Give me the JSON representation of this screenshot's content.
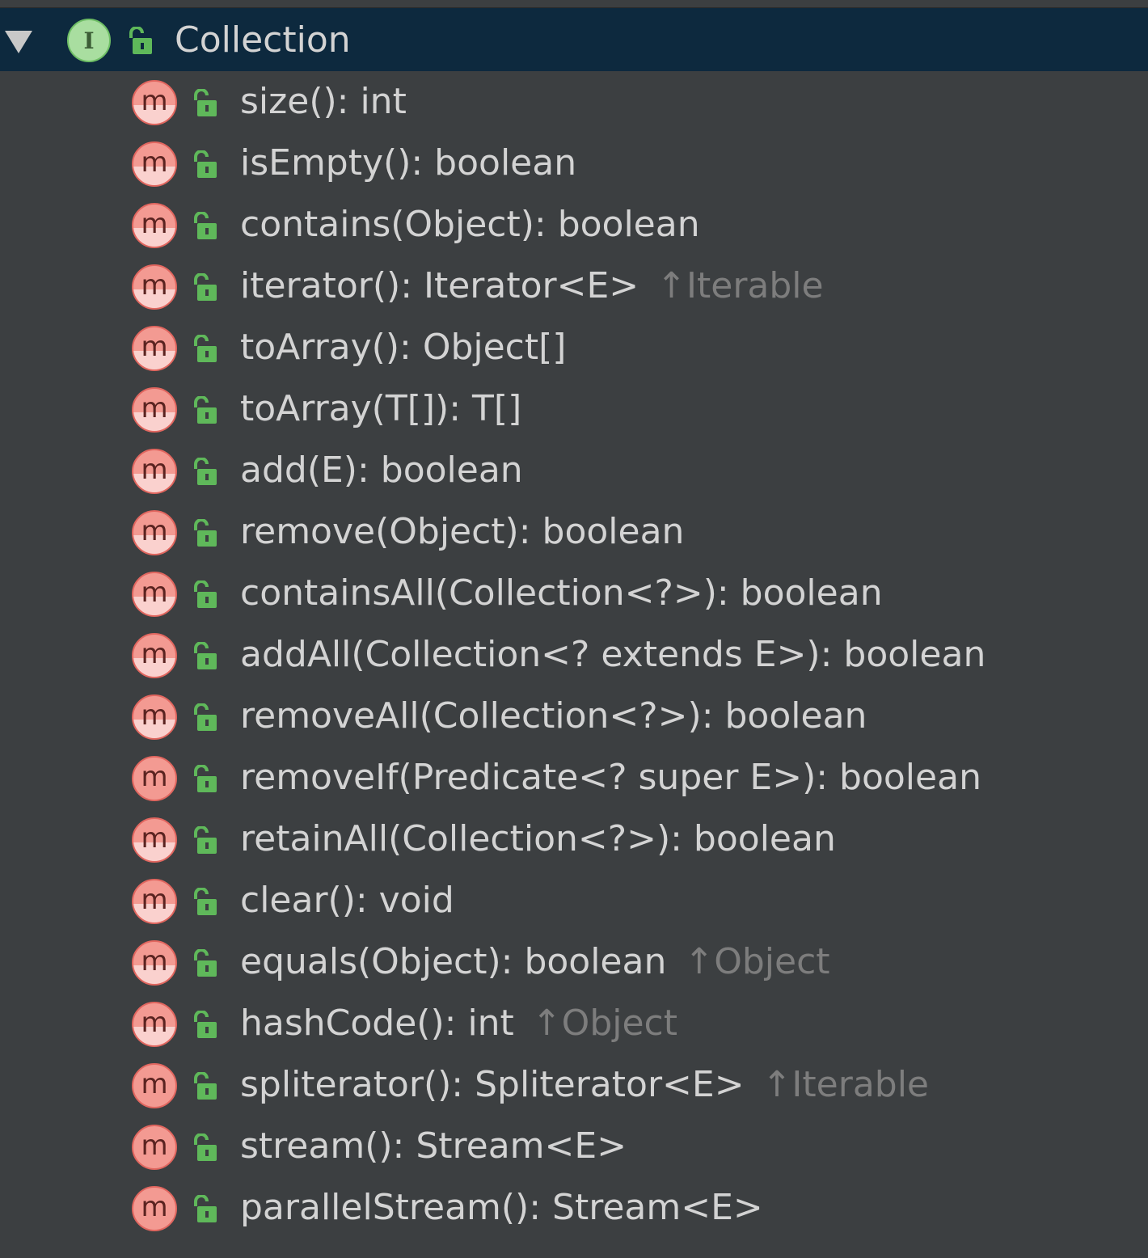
{
  "tree": {
    "root": {
      "label": "Collection",
      "icon": "interface-icon",
      "icon_letter": "I",
      "expanded": true,
      "selected": true
    },
    "members": [
      {
        "signature": "size(): int",
        "inherited": "",
        "abstract": true
      },
      {
        "signature": "isEmpty(): boolean",
        "inherited": "",
        "abstract": true
      },
      {
        "signature": "contains(Object): boolean",
        "inherited": "",
        "abstract": true
      },
      {
        "signature": "iterator(): Iterator<E>",
        "inherited": "↑Iterable",
        "abstract": true
      },
      {
        "signature": "toArray(): Object[]",
        "inherited": "",
        "abstract": true
      },
      {
        "signature": "toArray(T[]): T[]",
        "inherited": "",
        "abstract": true
      },
      {
        "signature": "add(E): boolean",
        "inherited": "",
        "abstract": true
      },
      {
        "signature": "remove(Object): boolean",
        "inherited": "",
        "abstract": true
      },
      {
        "signature": "containsAll(Collection<?>): boolean",
        "inherited": "",
        "abstract": true
      },
      {
        "signature": "addAll(Collection<? extends E>): boolean",
        "inherited": "",
        "abstract": true
      },
      {
        "signature": "removeAll(Collection<?>): boolean",
        "inherited": "",
        "abstract": true
      },
      {
        "signature": "removeIf(Predicate<? super E>): boolean",
        "inherited": "",
        "abstract": false
      },
      {
        "signature": "retainAll(Collection<?>): boolean",
        "inherited": "",
        "abstract": true
      },
      {
        "signature": "clear(): void",
        "inherited": "",
        "abstract": true
      },
      {
        "signature": "equals(Object): boolean",
        "inherited": "↑Object",
        "abstract": true
      },
      {
        "signature": "hashCode(): int",
        "inherited": "↑Object",
        "abstract": true
      },
      {
        "signature": "spliterator(): Spliterator<E>",
        "inherited": "↑Iterable",
        "abstract": false
      },
      {
        "signature": "stream(): Stream<E>",
        "inherited": "",
        "abstract": false
      },
      {
        "signature": "parallelStream(): Stream<E>",
        "inherited": "",
        "abstract": false
      }
    ],
    "method_icon_letter": "m"
  },
  "colors": {
    "background": "#3c3f41",
    "selection": "#0d293e",
    "text": "#d3d3d3",
    "inherited_text": "#7d7d7d",
    "method_icon": "#f39a92",
    "interface_icon": "#a9dea0",
    "public_lock": "#5fb85a"
  }
}
